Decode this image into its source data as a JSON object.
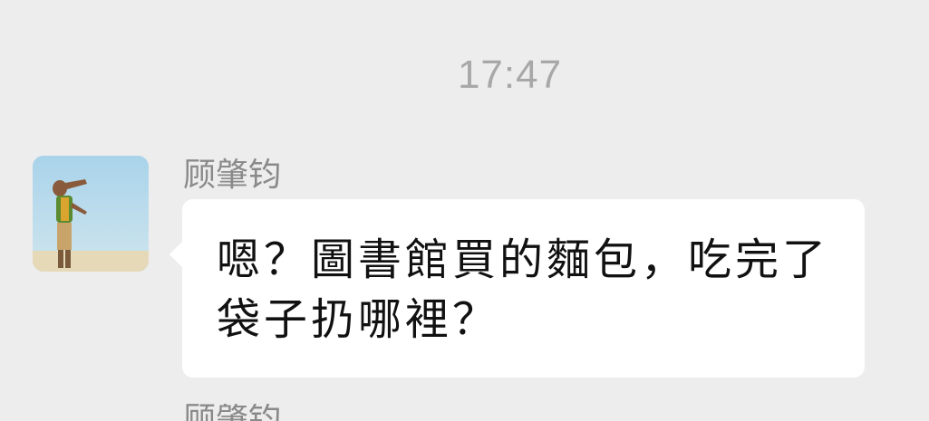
{
  "chat": {
    "timestamp": "17:47",
    "message": {
      "sender_name": "顾肇钧",
      "text": "嗯？圖書館買的麵包，吃完了袋子扔哪裡？"
    },
    "next_message": {
      "sender_name": "顾肇钧"
    }
  },
  "colors": {
    "background": "#ededed",
    "bubble": "#ffffff",
    "timestamp": "#a8a8a8",
    "sender_name": "#8a8a8a",
    "message_text": "#111111"
  }
}
